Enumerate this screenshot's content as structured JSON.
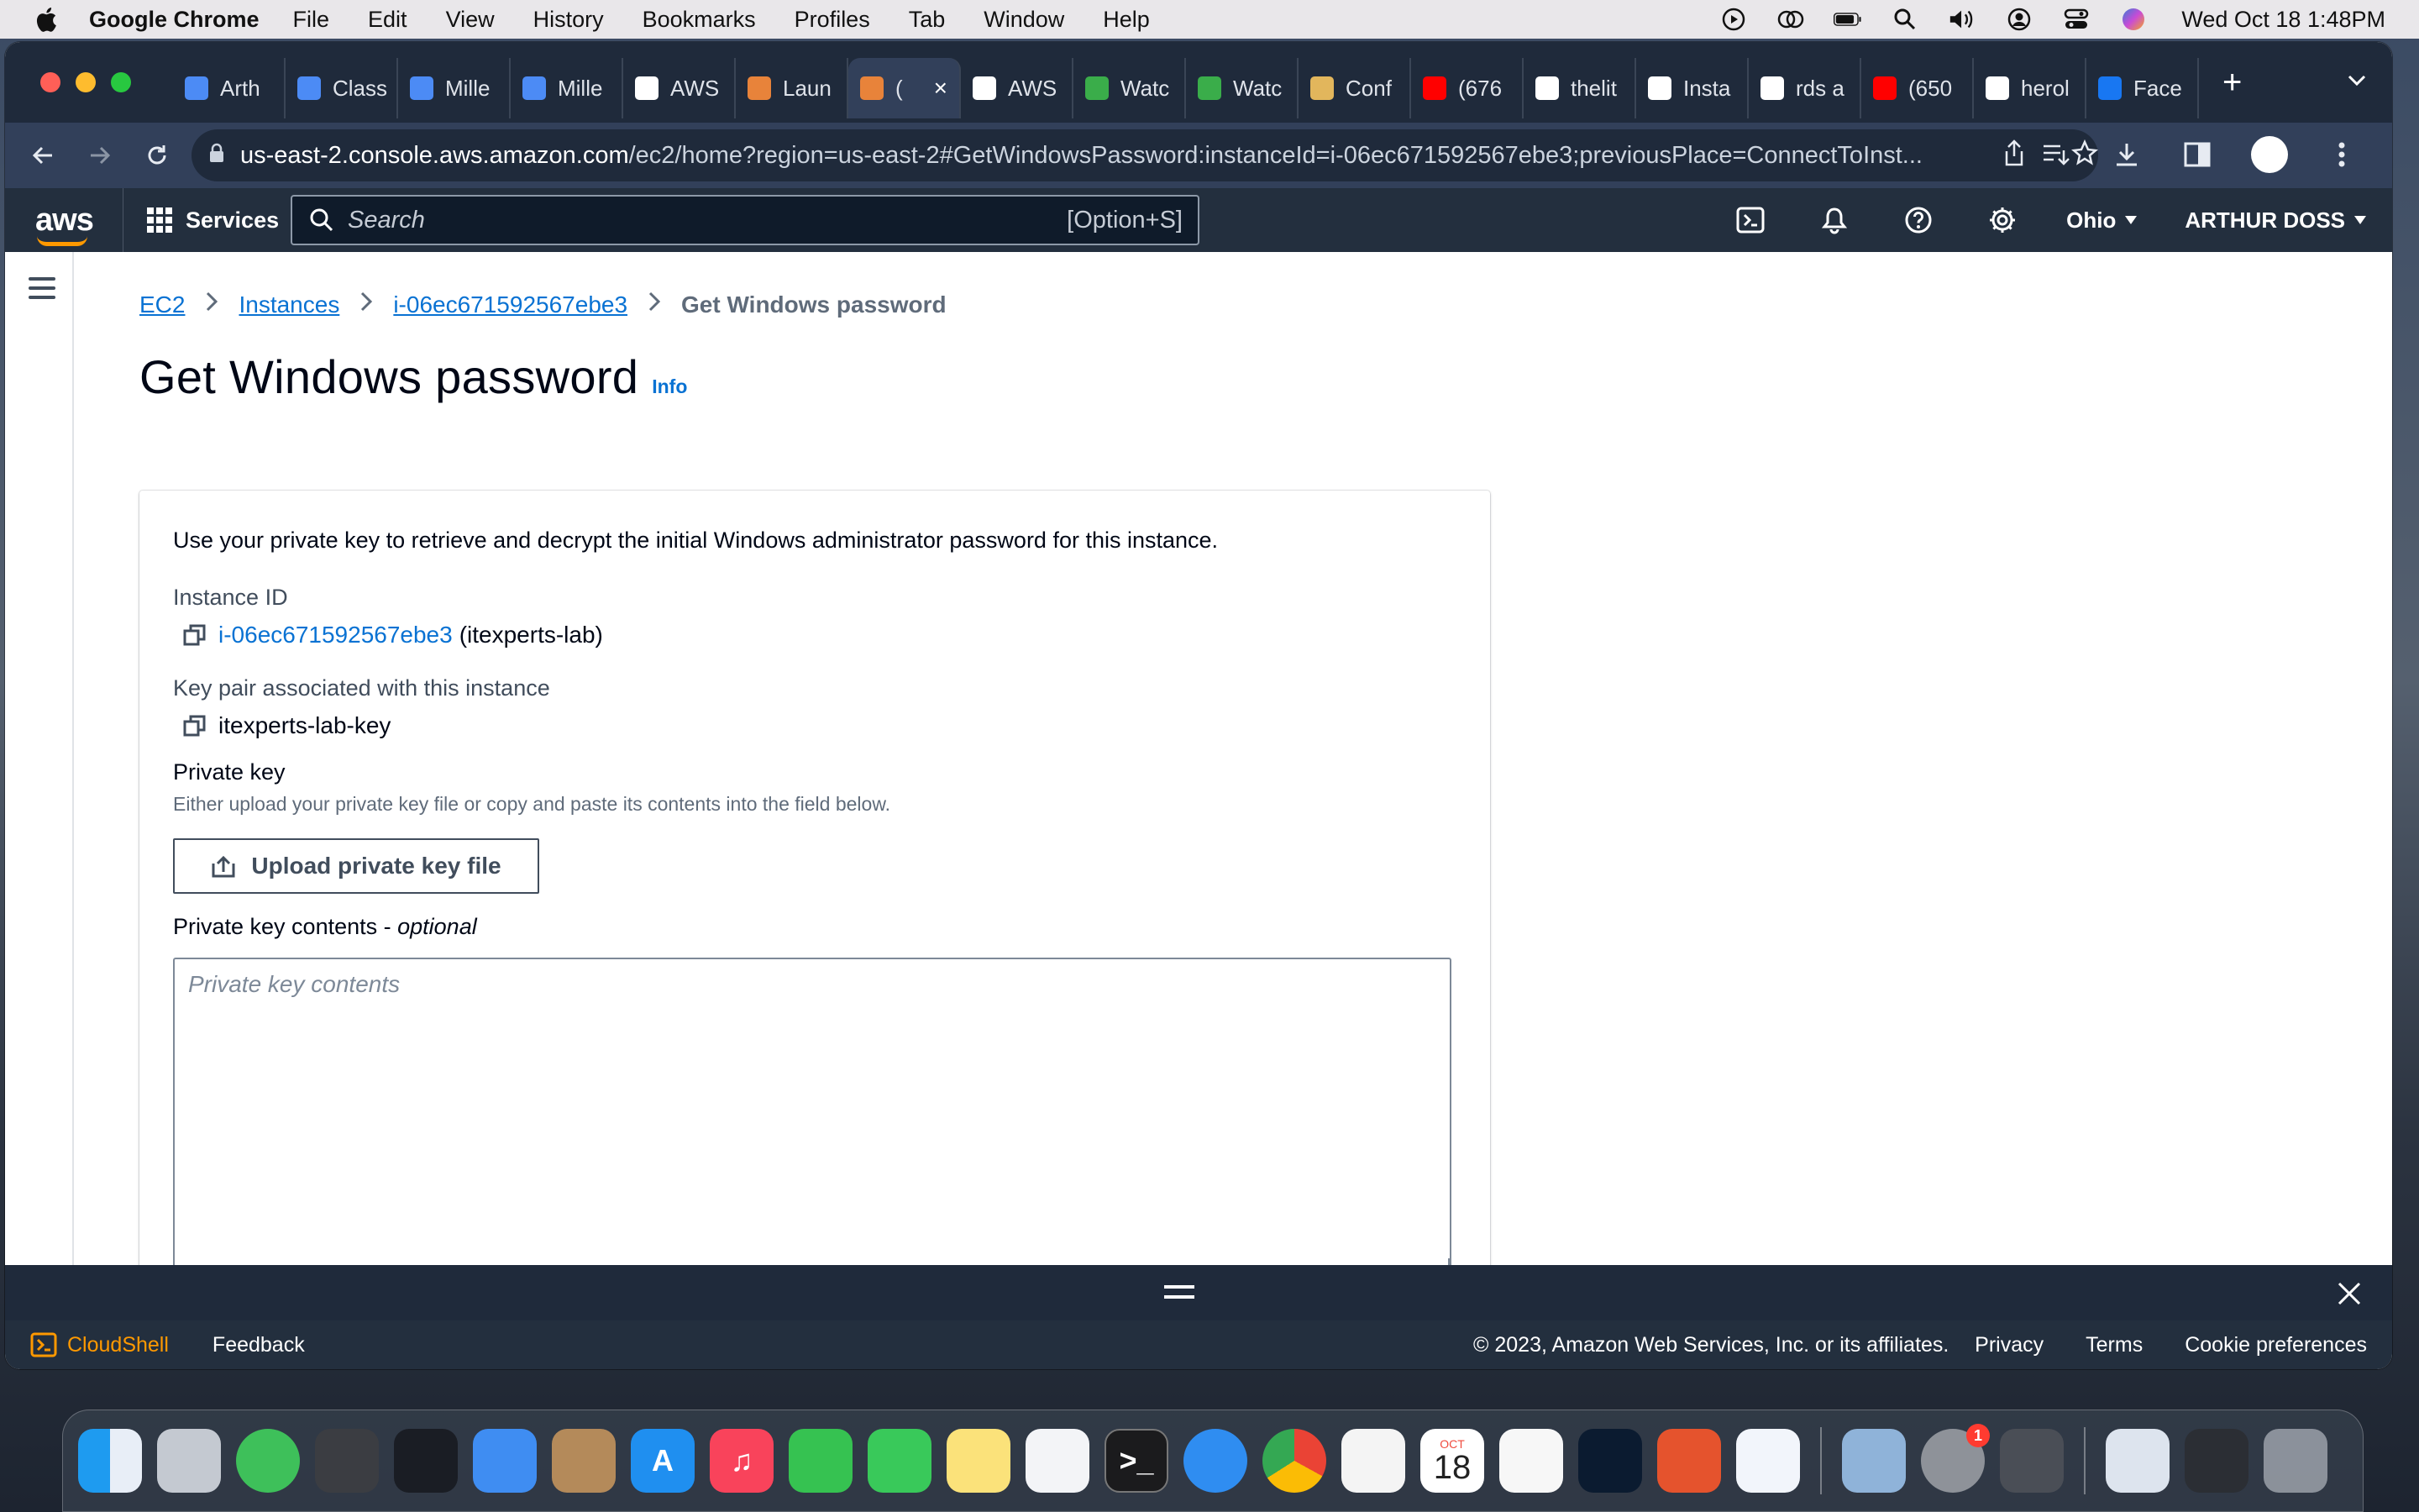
{
  "menubar": {
    "app_name": "Google Chrome",
    "items": [
      "File",
      "Edit",
      "View",
      "History",
      "Bookmarks",
      "Profiles",
      "Tab",
      "Window",
      "Help"
    ],
    "clock": "Wed Oct 18  1:48PM"
  },
  "tabs": [
    {
      "label": "Arth",
      "color": "#4c8bf5"
    },
    {
      "label": "Class",
      "color": "#4c8bf5"
    },
    {
      "label": "Mille",
      "color": "#4c8bf5"
    },
    {
      "label": "Mille",
      "color": "#4c8bf5"
    },
    {
      "label": "AWS",
      "color": "#ffffff"
    },
    {
      "label": "Laun",
      "color": "#e8833a"
    },
    {
      "label": "(",
      "color": "#e8833a",
      "active": true
    },
    {
      "label": "AWS",
      "color": "#ffffff"
    },
    {
      "label": "Watc",
      "color": "#3aad4a"
    },
    {
      "label": "Watc",
      "color": "#3aad4a"
    },
    {
      "label": "Conf",
      "color": "#e2b65c"
    },
    {
      "label": "(676",
      "color": "#ff0000"
    },
    {
      "label": "thelit",
      "color": "#ffffff"
    },
    {
      "label": "Insta",
      "color": "#ffffff"
    },
    {
      "label": "rds a",
      "color": "#ffffff"
    },
    {
      "label": "(650",
      "color": "#ff0000"
    },
    {
      "label": "herol",
      "color": "#ffffff"
    },
    {
      "label": "Face",
      "color": "#1877f2"
    }
  ],
  "address": {
    "host": "us-east-2.console.aws.amazon.com",
    "path": "/ec2/home?region=us-east-2#GetWindowsPassword:instanceId=i-06ec671592567ebe3;previousPlace=ConnectToInst..."
  },
  "aws_header": {
    "logo": "aws",
    "services": "Services",
    "search_placeholder": "Search",
    "search_shortcut": "[Option+S]",
    "region": "Ohio",
    "account": "ARTHUR DOSS"
  },
  "breadcrumb": {
    "ec2": "EC2",
    "instances": "Instances",
    "instance": "i-06ec671592567ebe3",
    "current": "Get Windows password"
  },
  "page": {
    "title": "Get Windows password",
    "info": "Info",
    "description": "Use your private key to retrieve and decrypt the initial Windows administrator password for this instance.",
    "instance_id_label": "Instance ID",
    "instance_id": "i-06ec671592567ebe3",
    "instance_name": "(itexperts-lab)",
    "key_pair_label": "Key pair associated with this instance",
    "key_pair": "itexperts-lab-key",
    "private_key_label": "Private key",
    "private_key_hint": "Either upload your private key file or copy and paste its contents into the field below.",
    "upload_button": "Upload private key file",
    "private_key_contents_label": "Private key contents - ",
    "optional": "optional",
    "private_key_placeholder": "Private key contents"
  },
  "footer": {
    "cloudshell": "CloudShell",
    "feedback": "Feedback",
    "copyright": "© 2023, Amazon Web Services, Inc. or its affiliates.",
    "privacy": "Privacy",
    "terms": "Terms",
    "cookies": "Cookie preferences"
  },
  "dock": {
    "calendar_month": "OCT",
    "calendar_day": "18",
    "settings_badge": "1"
  }
}
